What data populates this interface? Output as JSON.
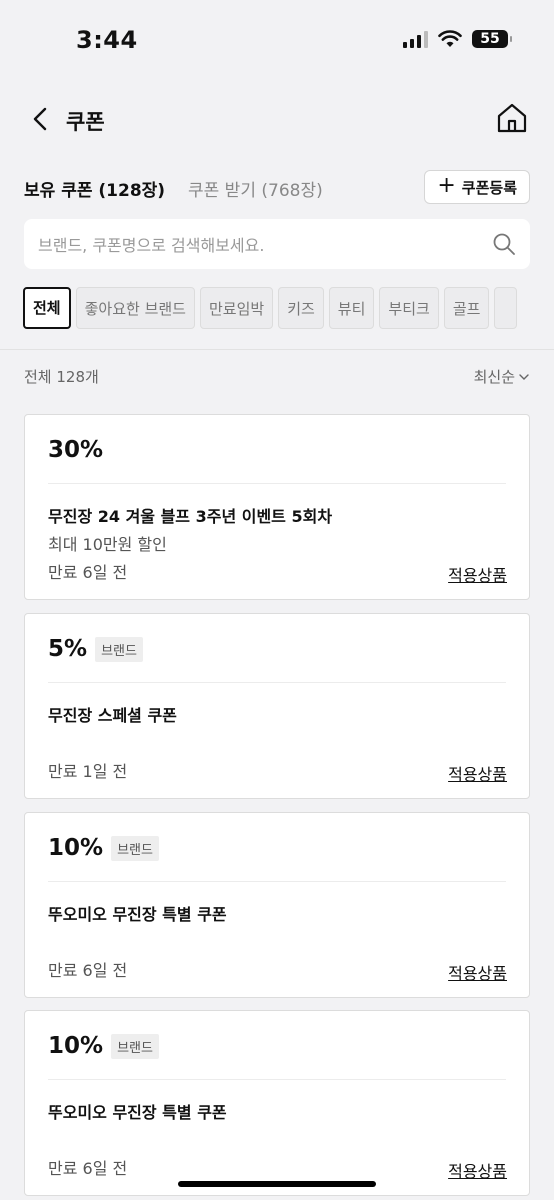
{
  "status_bar": {
    "time": "3:44",
    "battery": "55",
    "icons": [
      "signal-icon",
      "wifi-icon",
      "battery-icon"
    ]
  },
  "header": {
    "title": "쿠폰",
    "back_icon": "chevron-left-icon",
    "home_icon": "home-icon"
  },
  "tabs": {
    "owned": "보유 쿠폰 (128장)",
    "receive": "쿠폰 받기 (768장)",
    "register": "쿠폰등록"
  },
  "search": {
    "placeholder": "브랜드, 쿠폰명으로 검색해보세요.",
    "value": ""
  },
  "filters": [
    "전체",
    "좋아요한 브랜드",
    "만료임박",
    "키즈",
    "뷰티",
    "부티크",
    "골프"
  ],
  "active_filter": "전체",
  "list": {
    "count": "전체 128개",
    "sort": "최신순"
  },
  "coupons": [
    {
      "discount": "30%",
      "badge": "",
      "name": "무진장 24 겨울 블프 3주년 이벤트 5회차",
      "sub": "최대 10만원 할인",
      "expiry": "만료 6일 전",
      "link": "적용상품"
    },
    {
      "discount": "5%",
      "badge": "브랜드",
      "name": "무진장 스페셜 쿠폰",
      "sub": "",
      "expiry": "만료 1일 전",
      "link": "적용상품"
    },
    {
      "discount": "10%",
      "badge": "브랜드",
      "name": "뚜오미오 무진장 특별 쿠폰",
      "sub": "",
      "expiry": "만료 6일 전",
      "link": "적용상품"
    },
    {
      "discount": "10%",
      "badge": "브랜드",
      "name": "뚜오미오 무진장 특별 쿠폰",
      "sub": "",
      "expiry": "만료 6일 전",
      "link": "적용상품"
    }
  ],
  "colors": {
    "background": "#f2f2f4",
    "card": "#ffffff",
    "text": "#111111",
    "muted": "#888888"
  }
}
